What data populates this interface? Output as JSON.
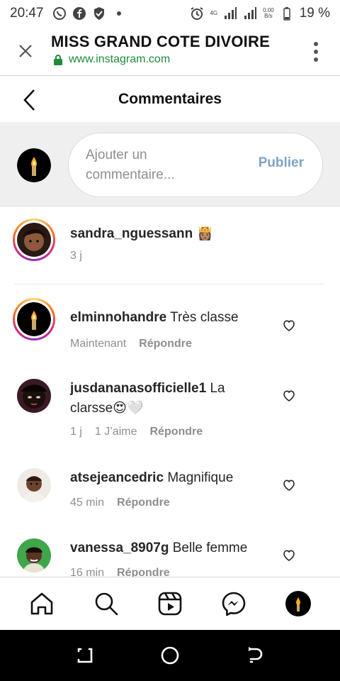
{
  "status_bar": {
    "time": "20:47",
    "network_label": "4G",
    "speed_value": "0.00",
    "speed_unit": "B/s",
    "battery": "19 %"
  },
  "browser": {
    "title": "MISS GRAND COTE DIVOIRE",
    "url": "www.instagram.com"
  },
  "page": {
    "title": "Commentaires"
  },
  "composer": {
    "placeholder": "Ajouter un commentaire...",
    "publish_label": "Publier"
  },
  "caption": {
    "username": "sandra_nguessann",
    "emoji": "👸🏽",
    "time": "3 j"
  },
  "comments": [
    {
      "username": "elminnohandre",
      "text": "Très classe",
      "time": "Maintenant",
      "likes": "",
      "reply_label": "Répondre"
    },
    {
      "username": "jusdananasofficielle1",
      "text": "La clarsse😍🤍",
      "time": "1 j",
      "likes": "1 J’aime",
      "reply_label": "Répondre"
    },
    {
      "username": "atsejeancedric",
      "text": "Magnifique",
      "time": "45 min",
      "likes": "",
      "reply_label": "Répondre"
    },
    {
      "username": "vanessa_8907g",
      "text": "Belle femme",
      "time": "16 min",
      "likes": "",
      "reply_label": "Répondre"
    }
  ],
  "colors": {
    "accent_link": "#7fa3c6",
    "secure_green": "#1e8a3a",
    "story_ring": "#d62976"
  }
}
